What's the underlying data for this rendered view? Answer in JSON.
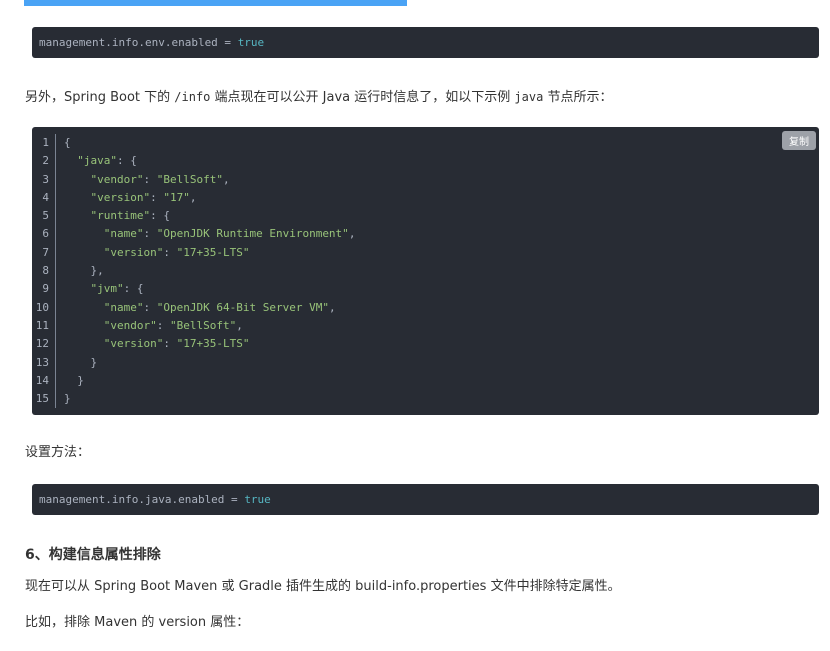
{
  "top_block": {
    "text": "management.info.env.enabled",
    "op": " = ",
    "value": "true"
  },
  "para1": {
    "part1": "另外，Spring Boot 下的 ",
    "code1": "/info",
    "part2": " 端点现在可以公开 Java 运行时信息了，如以下示例 ",
    "code2": "java",
    "part3": " 节点所示："
  },
  "code_block": {
    "copy_label": "复制",
    "line_numbers": [
      "1",
      "2",
      "3",
      "4",
      "5",
      "6",
      "7",
      "8",
      "9",
      "10",
      "11",
      "12",
      "13",
      "14",
      "15"
    ],
    "lines": [
      {
        "indent": "",
        "key": "",
        "rest": "{"
      },
      {
        "indent": "  ",
        "key": "\"java\"",
        "rest": ": {"
      },
      {
        "indent": "    ",
        "key": "\"vendor\"",
        "rest": ": ",
        "str": "\"BellSoft\"",
        "tail": ","
      },
      {
        "indent": "    ",
        "key": "\"version\"",
        "rest": ": ",
        "str": "\"17\"",
        "tail": ","
      },
      {
        "indent": "    ",
        "key": "\"runtime\"",
        "rest": ": {"
      },
      {
        "indent": "      ",
        "key": "\"name\"",
        "rest": ": ",
        "str": "\"OpenJDK Runtime Environment\"",
        "tail": ","
      },
      {
        "indent": "      ",
        "key": "\"version\"",
        "rest": ": ",
        "str": "\"17+35-LTS\"",
        "tail": ""
      },
      {
        "indent": "    ",
        "key": "",
        "rest": "},"
      },
      {
        "indent": "    ",
        "key": "\"jvm\"",
        "rest": ": {"
      },
      {
        "indent": "      ",
        "key": "\"name\"",
        "rest": ": ",
        "str": "\"OpenJDK 64-Bit Server VM\"",
        "tail": ","
      },
      {
        "indent": "      ",
        "key": "\"vendor\"",
        "rest": ": ",
        "str": "\"BellSoft\"",
        "tail": ","
      },
      {
        "indent": "      ",
        "key": "\"version\"",
        "rest": ": ",
        "str": "\"17+35-LTS\"",
        "tail": ""
      },
      {
        "indent": "    ",
        "key": "",
        "rest": "}"
      },
      {
        "indent": "  ",
        "key": "",
        "rest": "}"
      },
      {
        "indent": "",
        "key": "",
        "rest": "}"
      }
    ]
  },
  "para2": "设置方法：",
  "bottom_block": {
    "text": "management.info.java.enabled",
    "op": " = ",
    "value": "true"
  },
  "heading": "6、构建信息属性排除",
  "para3": "现在可以从 Spring Boot Maven 或 Gradle 插件生成的 build-info.properties 文件中排除特定属性。",
  "para4": "比如，排除 Maven 的 version 属性："
}
